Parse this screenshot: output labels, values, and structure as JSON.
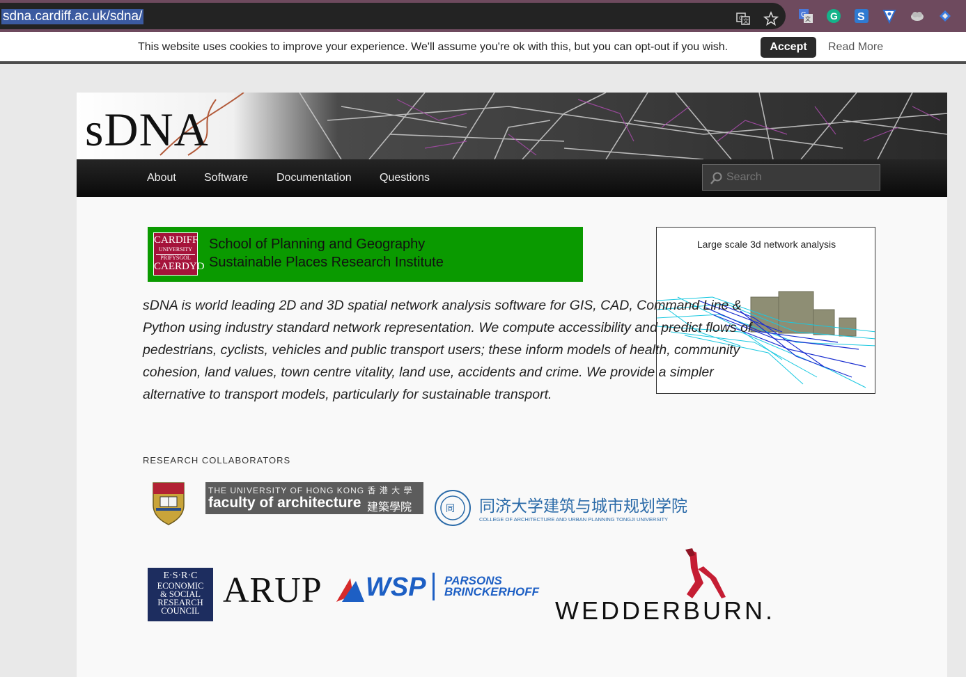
{
  "browser": {
    "url": "sdna.cardiff.ac.uk/sdna/",
    "icons": [
      "translate-icon",
      "star-icon",
      "google-translate-extension-icon",
      "grammarly-icon",
      "s-extension-icon",
      "shield-extension-icon",
      "cloud-extension-icon",
      "bookmark-extension-icon"
    ]
  },
  "cookie": {
    "text": "This website uses cookies to improve your experience. We'll assume you're ok with this, but you can opt-out if you wish.",
    "accept": "Accept",
    "read_more": "Read More"
  },
  "site": {
    "logo": "sDNA",
    "nav": [
      "About",
      "Software",
      "Documentation",
      "Questions"
    ],
    "search_placeholder": "Search"
  },
  "banner": {
    "logo_lines": [
      "CARDIFF",
      "UNIVERSITY",
      "PRIFYSGOL",
      "CAERDYD"
    ],
    "line1": "School of Planning and Geography",
    "line2": "Sustainable Places Research Institute"
  },
  "intro": "sDNA is world leading 2D and 3D spatial network analysis software for GIS, CAD, Command Line & Python using industry standard network representation.  We compute accessibility and predict flows of pedestrians, cyclists, vehicles and public transport users; these inform models of health, community cohesion, land values, town centre vitality, land use, accidents and crime.  We provide a simpler alternative to transport models, particularly for sustainable transport.",
  "figure": {
    "title": "Large scale 3d network analysis"
  },
  "collaborators": {
    "heading": "RESEARCH COLLABORATORS",
    "hku": {
      "line1": "THE UNIVERSITY OF HONG KONG 香 港 大 學",
      "line2": "faculty of architecture",
      "line2_cn": "建築學院"
    },
    "tongji": {
      "cn": "同济大学建筑与城市规划学院",
      "en": "COLLEGE OF ARCHITECTURE AND URBAN PLANNING TONGJI UNIVERSITY"
    },
    "esrc": [
      "E·S·R·C",
      "ECONOMIC",
      "& SOCIAL",
      "RESEARCH",
      "COUNCIL"
    ],
    "arup": "ARUP",
    "wsp": {
      "wsp": "WSP",
      "pb1": "PARSONS",
      "pb2": "BRINCKERHOFF"
    },
    "wedderburn": "WEDDERBURN."
  },
  "colors": {
    "nav_bg": "#111111",
    "banner_green": "#0a9a00",
    "cardiff_red": "#a5133a",
    "accept_bg": "#2b2b2b"
  }
}
